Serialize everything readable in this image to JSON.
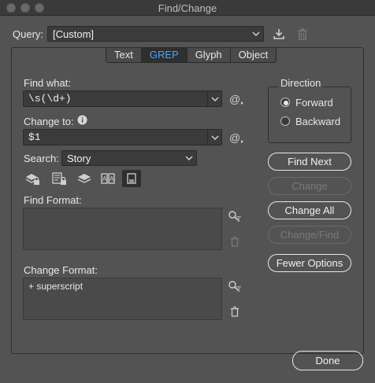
{
  "window": {
    "title": "Find/Change"
  },
  "query": {
    "label": "Query:",
    "value": "[Custom]"
  },
  "tabs": [
    {
      "label": "Text",
      "active": false
    },
    {
      "label": "GREP",
      "active": true
    },
    {
      "label": "Glyph",
      "active": false
    },
    {
      "label": "Object",
      "active": false
    }
  ],
  "find_what": {
    "label": "Find what:",
    "value": "\\s(\\d+)"
  },
  "change_to": {
    "label": "Change to:",
    "value": "$1"
  },
  "search": {
    "label": "Search:",
    "value": "Story"
  },
  "find_format": {
    "label": "Find Format:",
    "value": ""
  },
  "change_format": {
    "label": "Change Format:",
    "value": "+ superscript"
  },
  "direction": {
    "label": "Direction",
    "options": [
      {
        "label": "Forward",
        "checked": true
      },
      {
        "label": "Backward",
        "checked": false
      }
    ]
  },
  "buttons": {
    "find_next": "Find Next",
    "change": "Change",
    "change_all": "Change All",
    "change_find": "Change/Find",
    "fewer_options": "Fewer Options",
    "done": "Done"
  },
  "colors": {
    "accent": "#46a5ff",
    "background": "#535353",
    "field": "#3b3b3b"
  }
}
